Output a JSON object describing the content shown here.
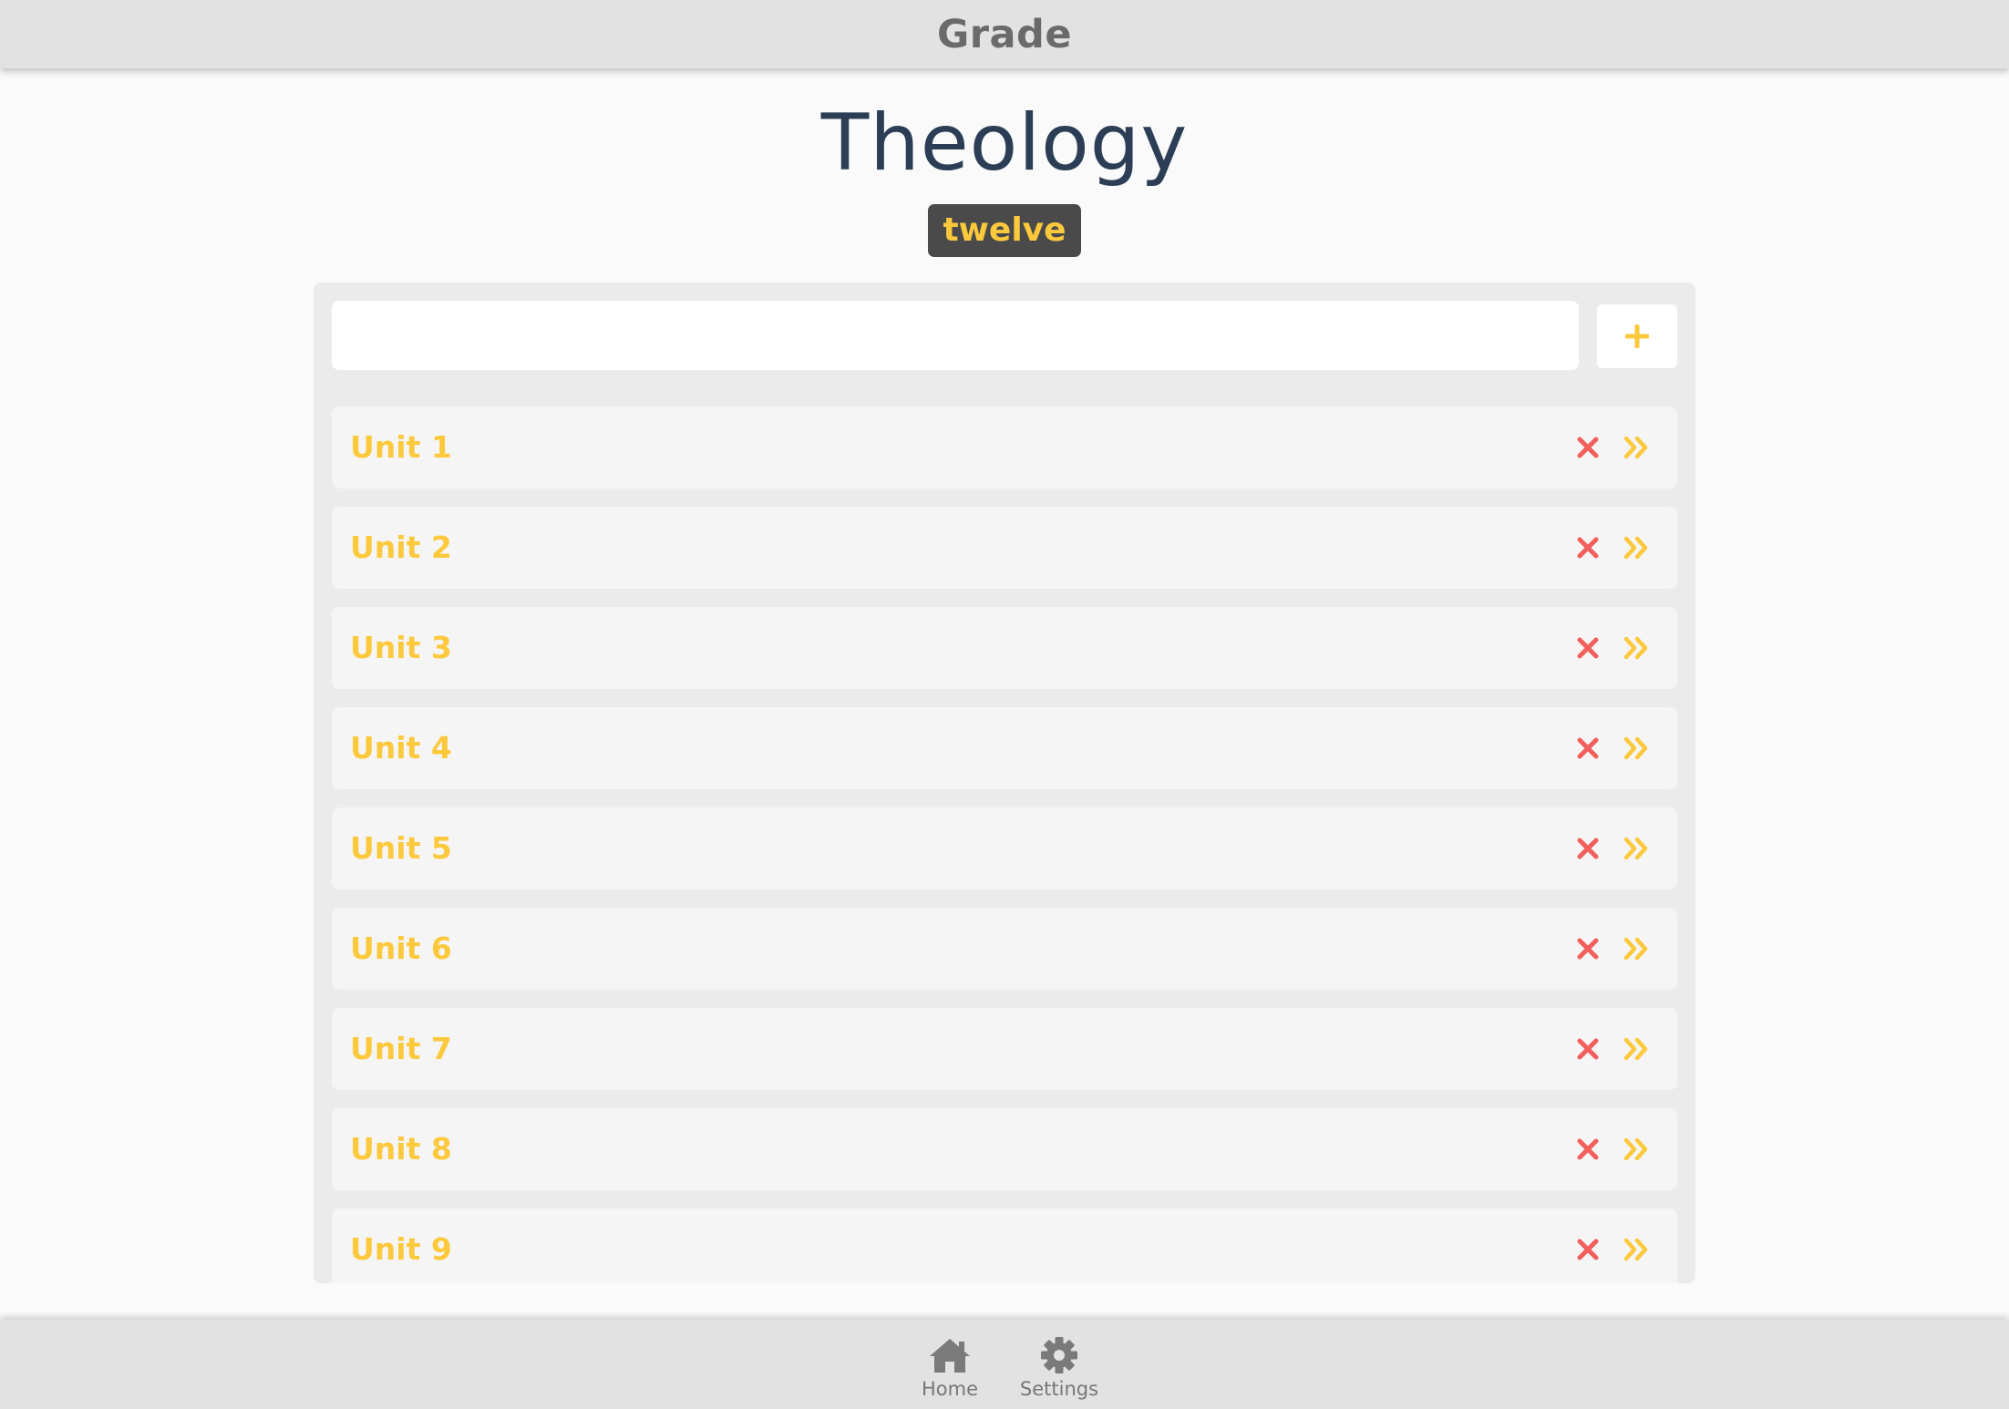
{
  "header": {
    "title": "Grade"
  },
  "subject": {
    "name": "Theology",
    "grade": "twelve"
  },
  "add_unit": {
    "input_value": "",
    "placeholder": "",
    "button_icon": "plus-icon"
  },
  "units": [
    {
      "label": "Unit 1"
    },
    {
      "label": "Unit 2"
    },
    {
      "label": "Unit 3"
    },
    {
      "label": "Unit 4"
    },
    {
      "label": "Unit 5"
    },
    {
      "label": "Unit 6"
    },
    {
      "label": "Unit 7"
    },
    {
      "label": "Unit 8"
    },
    {
      "label": "Unit 9"
    }
  ],
  "row_actions": {
    "delete_icon": "close-x-icon",
    "open_icon": "double-chevron-right-icon"
  },
  "bottom_nav": {
    "items": [
      {
        "label": "Home",
        "icon": "home-icon"
      },
      {
        "label": "Settings",
        "icon": "gear-icon"
      }
    ]
  },
  "colors": {
    "accent_yellow": "#fcc93d",
    "delete_red": "#f25f5c",
    "title_navy": "#2c3e55",
    "badge_bg": "#4a4a4a",
    "bar_gray": "#e2e2e2"
  }
}
